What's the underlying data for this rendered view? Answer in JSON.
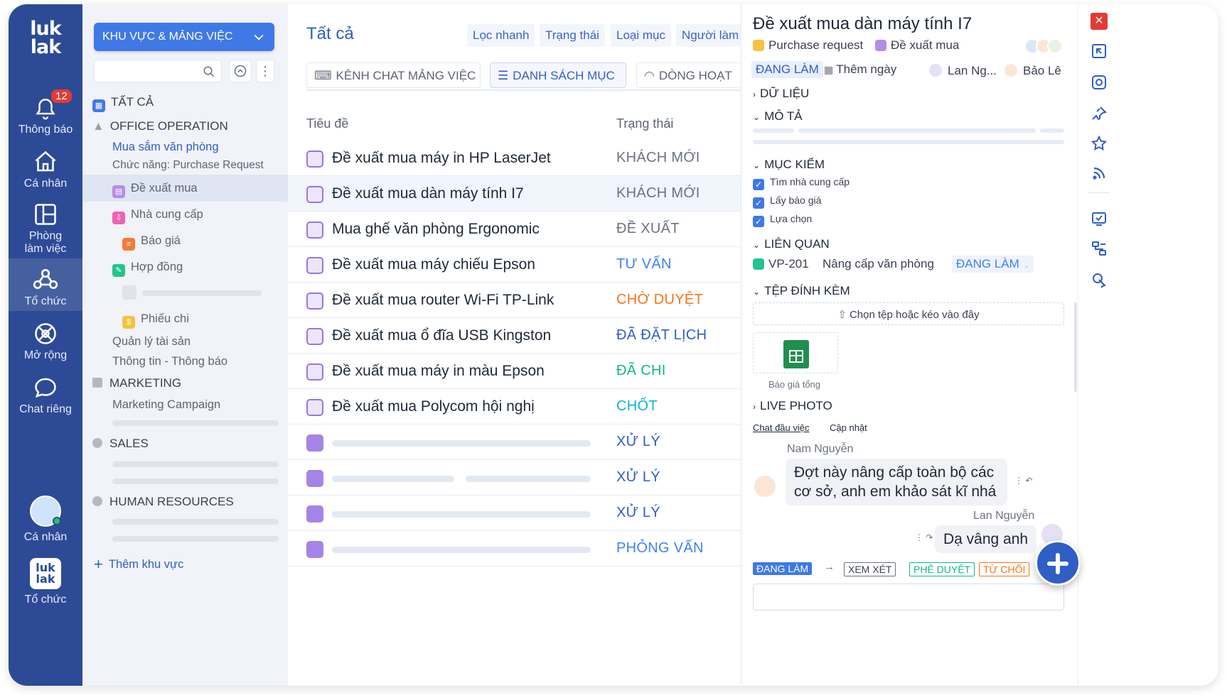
{
  "rail": {
    "logo": "luk lak",
    "notifications": {
      "label": "Thông báo",
      "count": "12"
    },
    "personal": "Cá nhân",
    "workroom": "Phòng làm việc",
    "organization": "Tổ chức",
    "extend": "Mở rộng",
    "private_chat": "Chat riêng",
    "user_label": "Cá nhân",
    "org_label": "Tổ chức"
  },
  "sidebar": {
    "workspace_select": "KHU VỰC & MẢNG VIỆC",
    "search_placeholder": "",
    "all": "TẤT CẢ",
    "office_group": "OFFICE OPERATION",
    "office_item": "Mua sắm văn phòng",
    "office_sub": "Chức năng: Purchase Request",
    "items": [
      "Đề xuất mua",
      "Nhà cung cấp",
      "Báo giá",
      "Hợp đồng",
      "Phiếu chi"
    ],
    "asset": "Quản lý tài sản",
    "info": "Thông tin - Thông báo",
    "marketing": "MARKETING",
    "marketing_item": "Marketing Campaign",
    "sales": "SALES",
    "hr": "HUMAN RESOURCES",
    "add_area": "Thêm khu vực"
  },
  "main": {
    "title": "Tất cả",
    "filters": [
      "Lọc nhanh",
      "Trạng thái",
      "Loại mục",
      "Người làm"
    ],
    "tabs": [
      "KÊNH CHAT MẢNG VIỆC",
      "DANH SÁCH MỤC",
      "DÒNG HOẠT"
    ],
    "col_title": "Tiêu đề",
    "col_status": "Trạng thái",
    "rows": [
      {
        "title": "Đề xuất mua máy in HP LaserJet",
        "status": "KHÁCH MỚI",
        "color": "#6b7280"
      },
      {
        "title": "Đề xuất mua dàn máy tính I7",
        "status": "KHÁCH MỚI",
        "color": "#6b7280"
      },
      {
        "title": "Mua ghế văn phòng Ergonomic",
        "status": "ĐỀ XUẤT",
        "color": "#6b7280"
      },
      {
        "title": "Đề xuất mua máy chiếu Epson",
        "status": "TƯ VẤN",
        "color": "#3b82f6"
      },
      {
        "title": "Đề xuất mua router Wi-Fi TP-Link",
        "status": "CHỜ DUYỆT",
        "color": "#f97316"
      },
      {
        "title": "Đề xuất mua ổ đĩa USB Kingston",
        "status": "ĐÃ ĐẶT LỊCH",
        "color": "#2f5ec4"
      },
      {
        "title": "Đề xuất mua máy in màu Epson",
        "status": "ĐÃ CHI",
        "color": "#10b981"
      },
      {
        "title": "Đề xuất mua Polycom hội nghị",
        "status": "CHỐT",
        "color": "#06b6d4"
      },
      {
        "title": "",
        "status": "XỬ LÝ",
        "color": "#2f5ec4"
      },
      {
        "title": "",
        "status": "XỬ LÝ",
        "color": "#2f5ec4"
      },
      {
        "title": "",
        "status": "XỬ LÝ",
        "color": "#2f5ec4"
      },
      {
        "title": "",
        "status": "PHỎNG VẤN",
        "color": "#3b82f6"
      }
    ]
  },
  "detail": {
    "title": "Đề xuất mua dàn máy tính I7",
    "type1": "Purchase request",
    "type2": "Đề xuất mua",
    "status": "ĐANG LÀM",
    "add_date": "Thêm ngày",
    "assignee1": "Lan Ng...",
    "assignee2": "Bảo Lê",
    "data_section": "DỮ LIỆU",
    "desc_section": "MÔ TẢ",
    "checklist_section": "MỤC KIỂM",
    "checklist": [
      "Tìm nhà cung cấp",
      "Lấy báo giá",
      "Lựa chọn"
    ],
    "related_section": "LIÊN QUAN",
    "related_id": "VP-201",
    "related_title": "Nâng cấp văn phòng",
    "related_status": "ĐANG LÀM",
    "attach_section": "TỆP ĐÍNH KÈM",
    "attach_prompt": "Chọn tệp hoặc kéo vào đây",
    "attach_file": "Báo giá tổng",
    "live_section": "LIVE PHOTO",
    "chat_tabs": [
      "Chat đầu việc",
      "Cập nhật"
    ],
    "msg1_author": "Nam Nguyễn",
    "msg1_text": "Đợt này nâng cấp toàn bộ các cơ sở, anh em khảo sát kĩ nhá",
    "msg2_author": "Lan Nguyễn",
    "msg2_text": "Dạ vâng anh",
    "workflow": [
      "ĐANG LÀM",
      "XEM XÉT",
      "PHÊ DUYỆT",
      "TỪ CHỐI"
    ]
  }
}
